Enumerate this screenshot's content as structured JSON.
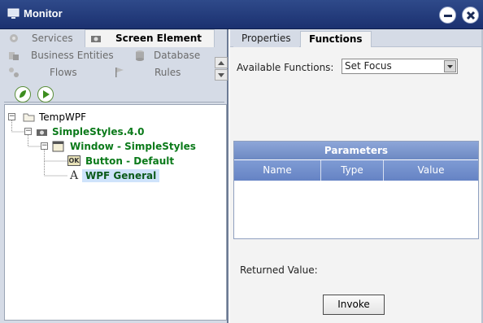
{
  "window": {
    "title": "Monitor"
  },
  "left_nav": {
    "tabs": [
      {
        "label": "Services",
        "icon": "gear-icon"
      },
      {
        "label": "Screen Element",
        "icon": "camera-icon",
        "active": true
      },
      {
        "label": "Business Entities",
        "icon": "entities-icon"
      },
      {
        "label": "Database",
        "icon": "database-icon"
      },
      {
        "label": "Flows",
        "icon": "flow-icon"
      },
      {
        "label": "Rules",
        "icon": "flag-icon"
      }
    ]
  },
  "tree": {
    "nodes": [
      {
        "label": "TempWPF",
        "icon": "folder-icon",
        "style": "plain",
        "toggle": "−"
      },
      {
        "label": "SimpleStyles.4.0",
        "icon": "camera-icon",
        "style": "green",
        "toggle": "−"
      },
      {
        "label": "Window - SimpleStyles",
        "icon": "window-icon",
        "style": "green",
        "toggle": "−"
      },
      {
        "label": "Button - Default",
        "icon": "button-ok-icon",
        "style": "green",
        "icon_text": "OK"
      },
      {
        "label": "WPF General",
        "icon": "text-a-icon",
        "style": "selected",
        "icon_text": "A"
      }
    ]
  },
  "right_tabs": [
    {
      "label": "Properties",
      "active": false
    },
    {
      "label": "Functions",
      "active": true
    }
  ],
  "functions": {
    "available_label": "Available Functions:",
    "selected": "Set Focus",
    "parameters_title": "Parameters",
    "columns": [
      "Name",
      "Type",
      "Value"
    ],
    "returned_label": "Returned Value:",
    "invoke_label": "Invoke"
  },
  "colors": {
    "titlebar": "#1f3675",
    "tree_green": "#0b7a1a",
    "params_header": "#7a95cf"
  }
}
